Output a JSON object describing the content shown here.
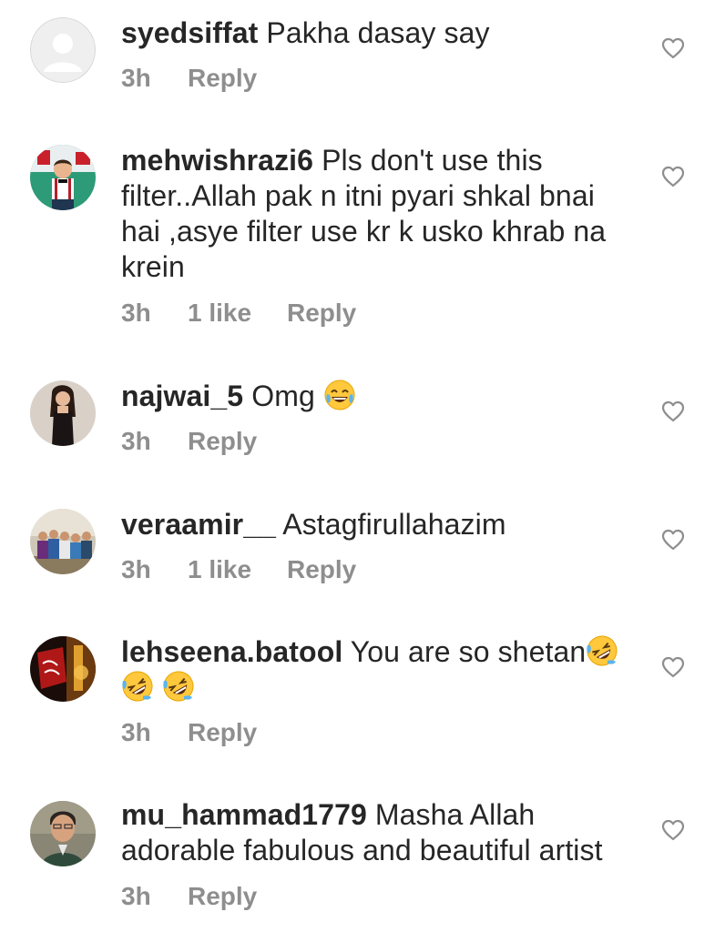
{
  "comments": [
    {
      "username": "syedsiffat",
      "text": "Pakha dasay say",
      "time": "3h",
      "likes": "",
      "reply": "Reply",
      "avatar": "default-avatar"
    },
    {
      "username": "mehwishrazi6",
      "text": "Pls don't use this filter..Allah pak n itni pyari shkal bnai hai ,asye filter use kr k usko khrab na krein",
      "time": "3h",
      "likes": "1 like",
      "reply": "Reply",
      "avatar": "child-photo-avatar"
    },
    {
      "username": "najwai_5",
      "text": "Omg",
      "time": "3h",
      "likes": "",
      "reply": "Reply",
      "avatar": "woman-photo-avatar",
      "emoji": "tears-of-joy-emoji"
    },
    {
      "username": "veraamir__",
      "text": "Astagfirullahazim",
      "time": "3h",
      "likes": "1 like",
      "reply": "Reply",
      "avatar": "group-photo-avatar"
    },
    {
      "username": "lehseena.batool",
      "text": "You are so shetan",
      "time": "3h",
      "likes": "",
      "reply": "Reply",
      "avatar": "red-calligraphy-avatar",
      "emoji": "rolling-laughing-emoji"
    },
    {
      "username": "mu_hammad1779",
      "text": "Masha Allah adorable fabulous and beautiful artist",
      "time": "3h",
      "likes": "",
      "reply": "Reply",
      "avatar": "man-photo-avatar"
    }
  ],
  "icons": {
    "like": "heart-outline-icon"
  },
  "colors": {
    "text": "#262626",
    "meta": "#8e8e8e",
    "background": "#ffffff"
  }
}
